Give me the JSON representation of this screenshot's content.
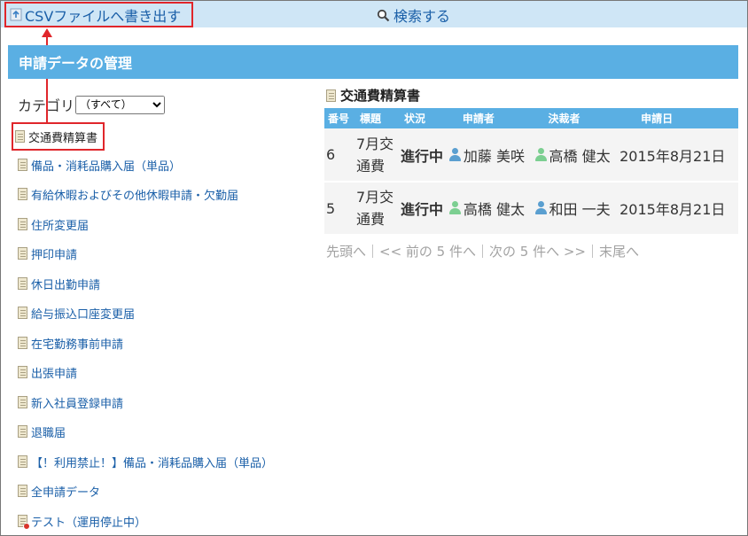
{
  "toolbar": {
    "csv_label": "CSVファイルへ書き出す",
    "search_label": "検索する"
  },
  "header": {
    "title": "申請データの管理"
  },
  "category": {
    "label": "カテゴリ",
    "selected": "（すべて）",
    "items": [
      "交通費精算書",
      "備品・消耗品購入届（単品）",
      "有給休暇およびその他休暇申請・欠勤届",
      "住所変更届",
      "押印申請",
      "休日出勤申請",
      "給与振込口座変更届",
      "在宅勤務事前申請",
      "出張申請",
      "新入社員登録申請",
      "退職届",
      "【！利用禁止！】備品・消耗品購入届（単品）",
      "全申請データ",
      "テスト（運用停止中）"
    ]
  },
  "main": {
    "title": "交通費精算書",
    "columns": [
      "番号",
      "標題",
      "状況",
      "申請者",
      "決裁者",
      "申請日"
    ],
    "rows": [
      {
        "num": "6",
        "title": "7月交通費",
        "status": "進行中",
        "applicant": "加藤 美咲",
        "approver": "高橋 健太",
        "date": "2015年8月21日"
      },
      {
        "num": "5",
        "title": "7月交通費",
        "status": "進行中",
        "applicant": "高橋 健太",
        "approver": "和田 一夫",
        "date": "2015年8月21日"
      }
    ],
    "pager": "先頭へ｜<< 前の 5 件へ｜次の 5 件へ >>｜末尾へ"
  },
  "colors": {
    "accent": "#5aafe3",
    "highlight": "#e0262b",
    "link": "#1a5fa8",
    "topbar": "#cfe6f6"
  }
}
